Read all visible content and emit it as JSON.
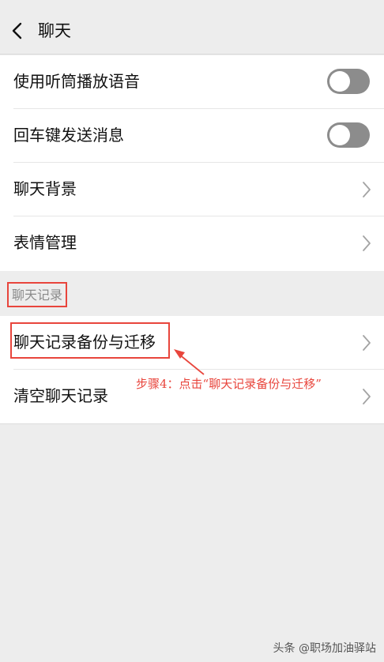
{
  "header": {
    "title": "聊天"
  },
  "settings": [
    {
      "label": "使用听筒播放语音",
      "control": "toggle",
      "enabled": false
    },
    {
      "label": "回车键发送消息",
      "control": "toggle",
      "enabled": false
    },
    {
      "label": "聊天背景",
      "control": "chevron"
    },
    {
      "label": "表情管理",
      "control": "chevron"
    }
  ],
  "section": {
    "label": "聊天记录"
  },
  "history": [
    {
      "label": "聊天记录备份与迁移"
    },
    {
      "label": "清空聊天记录"
    }
  ],
  "annotation": {
    "text": "步骤4：点击“聊天记录备份与迁移”",
    "color": "#e8453c"
  },
  "watermark": {
    "text": "头条 @职场加油驿站"
  }
}
